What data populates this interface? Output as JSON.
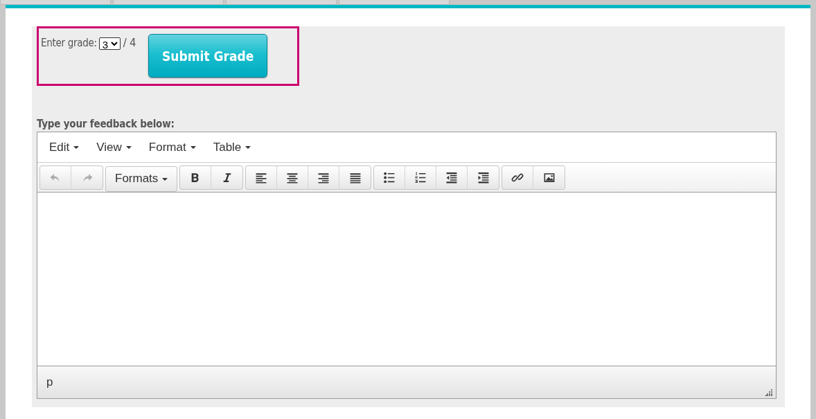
{
  "tabs": [
    {
      "selected": false
    },
    {
      "selected": false
    },
    {
      "selected": false
    },
    {
      "selected": false
    }
  ],
  "grade": {
    "highlighted": true,
    "label": "Enter grade:",
    "value": "3",
    "max": "/ 4",
    "submit": "Submit Grade"
  },
  "feedback": {
    "label": "Type your feedback below:",
    "menu": [
      "Edit",
      "View",
      "Format",
      "Table"
    ],
    "toolbar": [
      {
        "kind": "icons",
        "buttons": [
          {
            "disabled": true
          },
          {
            "disabled": true
          }
        ]
      },
      {
        "kind": "dropdown",
        "label": "Formats"
      },
      {
        "kind": "icons",
        "buttons": [
          {
            "disabled": false
          },
          {
            "disabled": false
          }
        ]
      },
      {
        "kind": "icons",
        "buttons": [
          {
            "disabled": false
          },
          {
            "disabled": false
          },
          {
            "disabled": false
          },
          {
            "disabled": false
          }
        ]
      },
      {
        "kind": "icons",
        "buttons": [
          {
            "disabled": false
          },
          {
            "disabled": false
          },
          {
            "disabled": false
          },
          {
            "disabled": false
          }
        ]
      },
      {
        "kind": "icons",
        "buttons": [
          {
            "disabled": false
          },
          {
            "disabled": false
          }
        ]
      }
    ],
    "path": "p"
  }
}
